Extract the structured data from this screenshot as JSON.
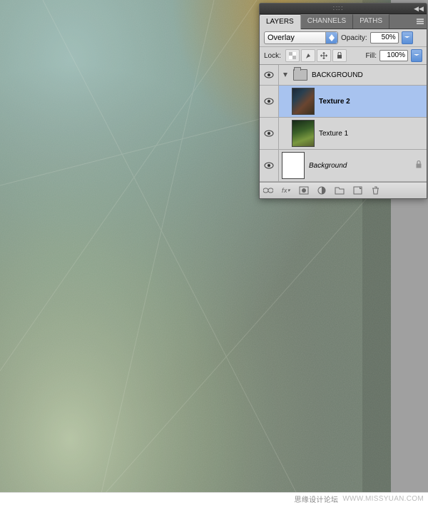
{
  "footer": {
    "cn_text": "思缘设计论坛",
    "url_text": "WWW.MISSYUAN.COM"
  },
  "panel": {
    "tabs": {
      "layers": "LAYERS",
      "channels": "CHANNELS",
      "paths": "PATHS"
    },
    "blend_row": {
      "mode": "Overlay",
      "opacity_label": "Opacity:",
      "opacity_value": "50%"
    },
    "lock_row": {
      "label": "Lock:",
      "fill_label": "Fill:",
      "fill_value": "100%"
    },
    "layers": {
      "group": {
        "name": "BACKGROUND"
      },
      "tex2": {
        "name": "Texture 2"
      },
      "tex1": {
        "name": "Texture 1"
      },
      "bg": {
        "name": "Background"
      }
    }
  }
}
